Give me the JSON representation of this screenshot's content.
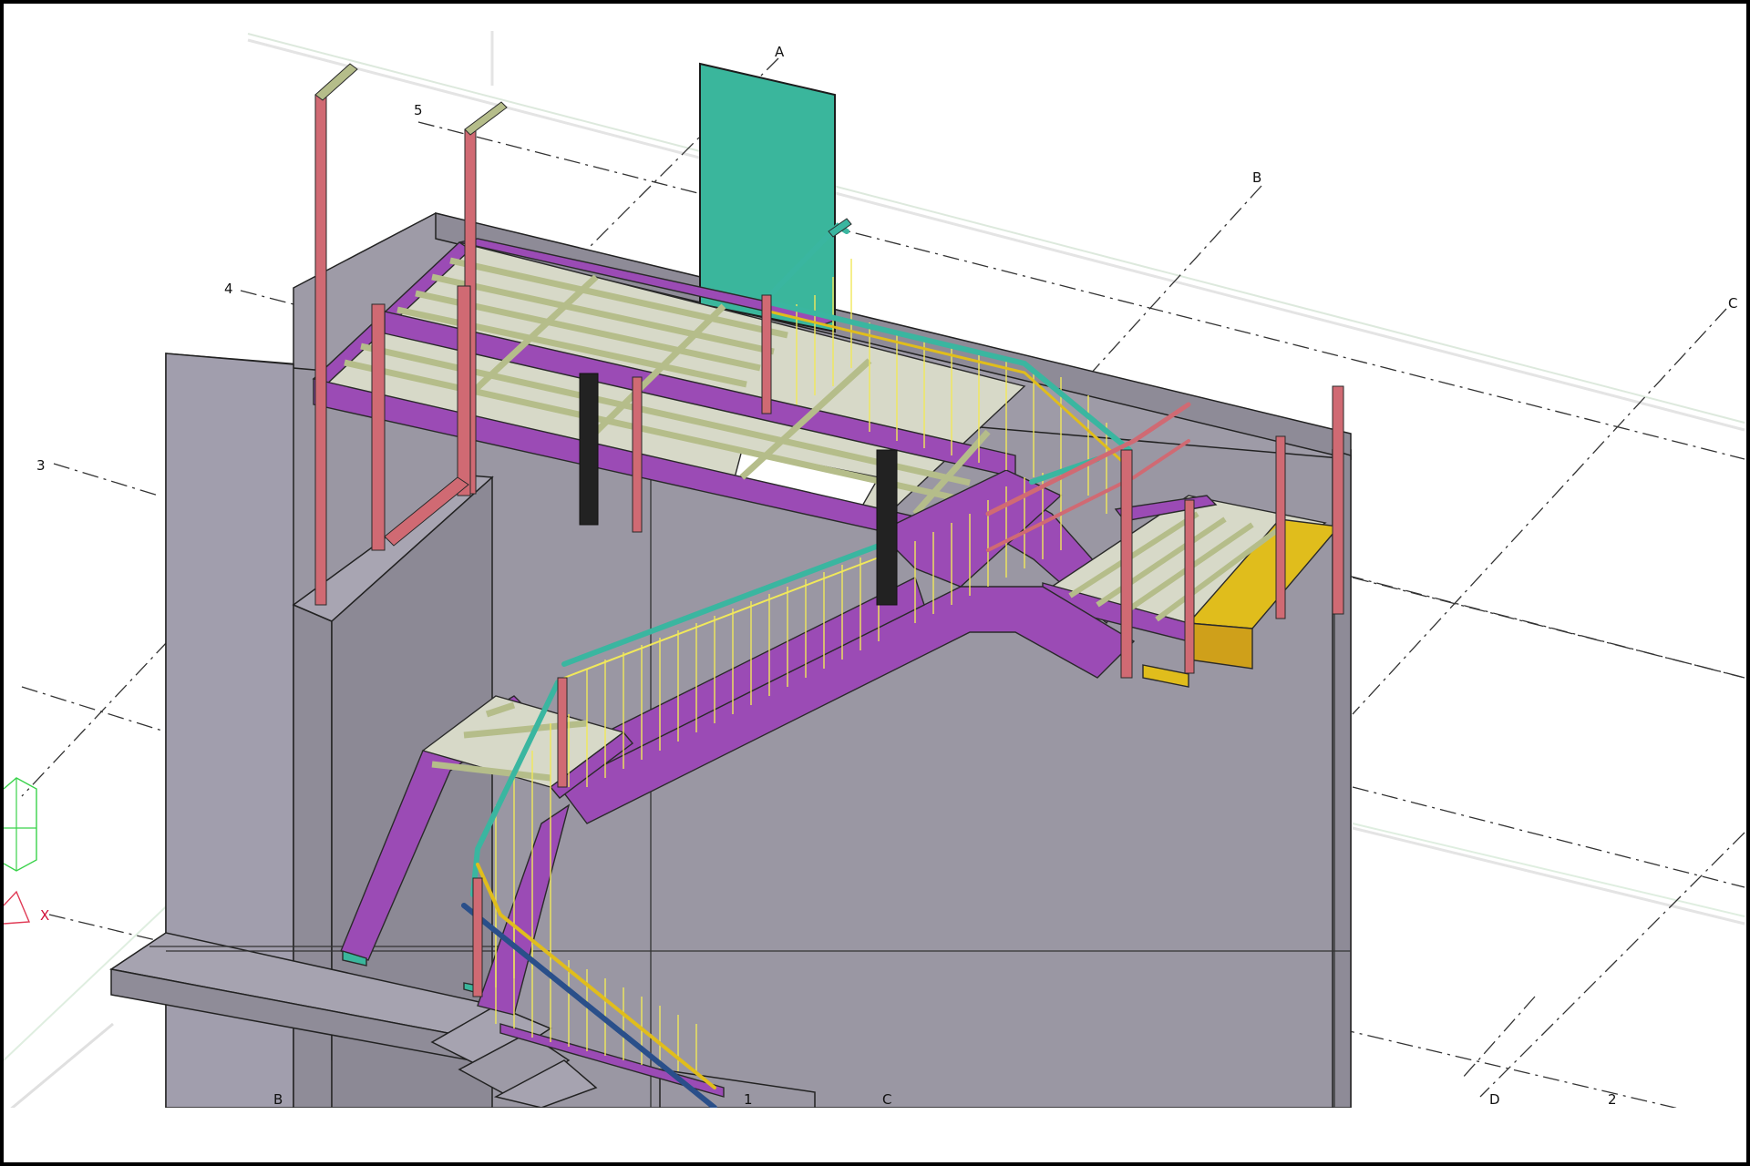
{
  "viewport": {
    "grid_labels": {
      "A": "A",
      "B_top": "B",
      "C_top": "C",
      "row_5": "5",
      "row_4": "4",
      "row_3": "3",
      "B_bottom": "B",
      "one_bottom": "1",
      "C_bottom": "C",
      "D_bottom": "D",
      "two_bottom": "2"
    },
    "axis_label": "X",
    "colors": {
      "concrete": "#9a97a3",
      "concrete_dark": "#7f7c88",
      "stringer": "#9b4bb5",
      "grating": "#b5bd8a",
      "handrail": "#3ab6a0",
      "post": "#d06a73",
      "kickplate": "#e0bd1c",
      "column": "#222222",
      "panel": "#3ab69c",
      "baluster": "#f1e85a",
      "diagonal": "#2a4f8a"
    }
  }
}
